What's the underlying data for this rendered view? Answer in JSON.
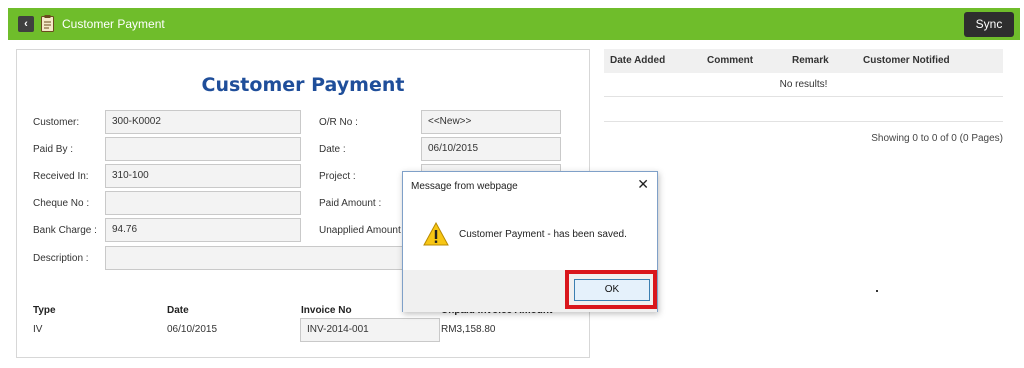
{
  "header": {
    "back_glyph": "‹",
    "title": "Customer Payment",
    "sync_label": "Sync",
    "accent_color": "#6fbd2b"
  },
  "form": {
    "title": "Customer Payment",
    "left_fields": [
      {
        "label": "Customer:",
        "value": "300-K0002"
      },
      {
        "label": "Paid By :",
        "value": ""
      },
      {
        "label": "Received In:",
        "value": "310-100"
      },
      {
        "label": "Cheque No :",
        "value": ""
      },
      {
        "label": "Bank Charge :",
        "value": "94.76"
      },
      {
        "label": "Description :",
        "value": ""
      }
    ],
    "right_fields": [
      {
        "label": "O/R No :",
        "value": "<<New>>"
      },
      {
        "label": "Date :",
        "value": "06/10/2015"
      },
      {
        "label": "Project :",
        "value": ""
      },
      {
        "label": "Paid Amount :",
        "value": ""
      },
      {
        "label": "Unapplied Amount :",
        "value": ""
      }
    ],
    "table": {
      "headers": [
        "Type",
        "Date",
        "Invoice No",
        "Unpaid Invoice Amount"
      ],
      "rows": [
        {
          "type": "IV",
          "date": "06/10/2015",
          "invoice_no": "INV-2014-001",
          "amount": "RM3,158.80"
        }
      ]
    }
  },
  "history": {
    "headers": [
      "Date Added",
      "Comment",
      "Remark",
      "Customer Notified"
    ],
    "empty_text": "No results!",
    "pagination": "Showing 0 to 0 of 0 (0 Pages)"
  },
  "dialog": {
    "title": "Message from webpage",
    "close_glyph": "✕",
    "message": "Customer Payment - has been saved.",
    "ok_label": "OK",
    "icon": "warning-icon",
    "highlight_color": "#d9161c"
  }
}
